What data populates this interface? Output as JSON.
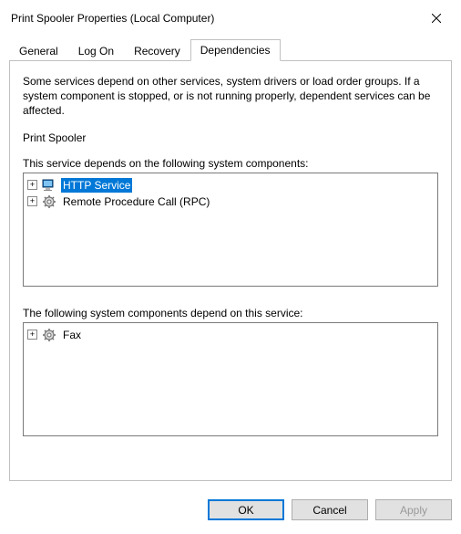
{
  "window": {
    "title": "Print Spooler Properties (Local Computer)"
  },
  "tabs": {
    "items": [
      {
        "label": "General"
      },
      {
        "label": "Log On"
      },
      {
        "label": "Recovery"
      },
      {
        "label": "Dependencies"
      }
    ],
    "active_index": 3
  },
  "dependencies_panel": {
    "description": "Some services depend on other services, system drivers or load order groups. If a system component is stopped, or is not running properly, dependent services can be affected.",
    "service_name": "Print Spooler",
    "depends_on_label": "This service depends on the following system components:",
    "depended_by_label": "The following system components depend on this service:",
    "depends_on": [
      {
        "label": "HTTP Service",
        "icon": "computer",
        "expandable": true,
        "selected": true
      },
      {
        "label": "Remote Procedure Call (RPC)",
        "icon": "gear",
        "expandable": true,
        "selected": false
      }
    ],
    "depended_by": [
      {
        "label": "Fax",
        "icon": "gear",
        "expandable": true,
        "selected": false
      }
    ]
  },
  "buttons": {
    "ok": "OK",
    "cancel": "Cancel",
    "apply": "Apply"
  }
}
